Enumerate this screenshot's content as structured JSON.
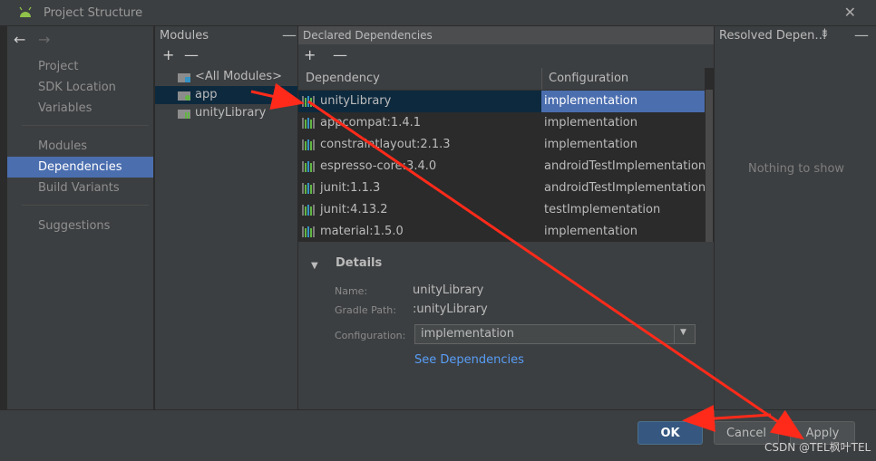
{
  "window": {
    "title": "Project Structure"
  },
  "nav": {
    "items": [
      "Project",
      "SDK Location",
      "Variables",
      "Modules",
      "Dependencies",
      "Build Variants",
      "Suggestions"
    ],
    "selected": "Dependencies"
  },
  "modules": {
    "title": "Modules",
    "items": [
      "<All Modules>",
      "app",
      "unityLibrary"
    ],
    "selected": "app"
  },
  "dependencies": {
    "title": "Declared Dependencies",
    "col_dependency": "Dependency",
    "col_configuration": "Configuration",
    "rows": [
      {
        "name": "unityLibrary",
        "config": "implementation"
      },
      {
        "name": "appcompat:1.4.1",
        "config": "implementation"
      },
      {
        "name": "constraintlayout:2.1.3",
        "config": "implementation"
      },
      {
        "name": "espresso-core:3.4.0",
        "config": "androidTestImplementation"
      },
      {
        "name": "junit:1.1.3",
        "config": "androidTestImplementation"
      },
      {
        "name": "junit:4.13.2",
        "config": "testImplementation"
      },
      {
        "name": "material:1.5.0",
        "config": "implementation"
      }
    ]
  },
  "details": {
    "title": "Details",
    "name_label": "Name:",
    "name_value": "unityLibrary",
    "path_label": "Gradle Path:",
    "path_value": ":unityLibrary",
    "conf_label": "Configuration:",
    "conf_value": "implementation",
    "see_link": "See Dependencies"
  },
  "resolved": {
    "title": "Resolved Depen…",
    "empty_text": "Nothing to show"
  },
  "buttons": {
    "ok": "OK",
    "cancel": "Cancel",
    "apply": "Apply"
  },
  "watermark": "CSDN @TEL枫叶TEL",
  "colors": {
    "accent": "#4b6eaf",
    "selection": "#0d293e",
    "link": "#589df6",
    "annotation": "#ff2a1a"
  }
}
